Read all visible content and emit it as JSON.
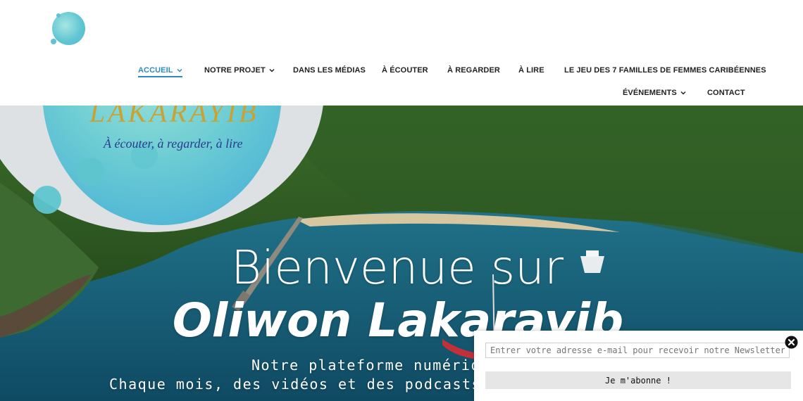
{
  "logo": {
    "alt": "Oliwon Lakarayib"
  },
  "nav": {
    "row1": [
      {
        "label": "ACCUEIL",
        "has_dropdown": true,
        "active": true
      },
      {
        "label": "NOTRE PROJET",
        "has_dropdown": true
      },
      {
        "label": "DANS LES MÉDIAS"
      },
      {
        "label": "À ÉCOUTER"
      },
      {
        "label": "À REGARDER"
      },
      {
        "label": "À LIRE"
      },
      {
        "label": "LE JEU DES 7 FAMILLES DE FEMMES CARIBÉENNES"
      }
    ],
    "row2": [
      {
        "label": "ÉVÉNEMENTS",
        "has_dropdown": true
      },
      {
        "label": "CONTACT"
      }
    ]
  },
  "hero": {
    "brand_title": "LAKARAYIB",
    "brand_tagline": "À écouter, à regarder, à lire",
    "heading_line1": "Bienvenue sur",
    "heading_line2": "Oliwon Lakarayib",
    "subtitle_line1": "Notre plateforme numérique dédiée",
    "subtitle_line2": "Chaque mois, des vidéos et des podcasts en histoire, géogra"
  },
  "newsletter": {
    "placeholder": "Entrer votre adresse e-mail pour recevoir notre Newsletter *",
    "button_label": "Je m'abonne !"
  },
  "colors": {
    "accent": "#2b8cc4",
    "brand_gold": "#c7a336",
    "brand_teal": "#5ec5cf"
  },
  "icons": [
    "chevron-down-icon",
    "close-icon"
  ]
}
